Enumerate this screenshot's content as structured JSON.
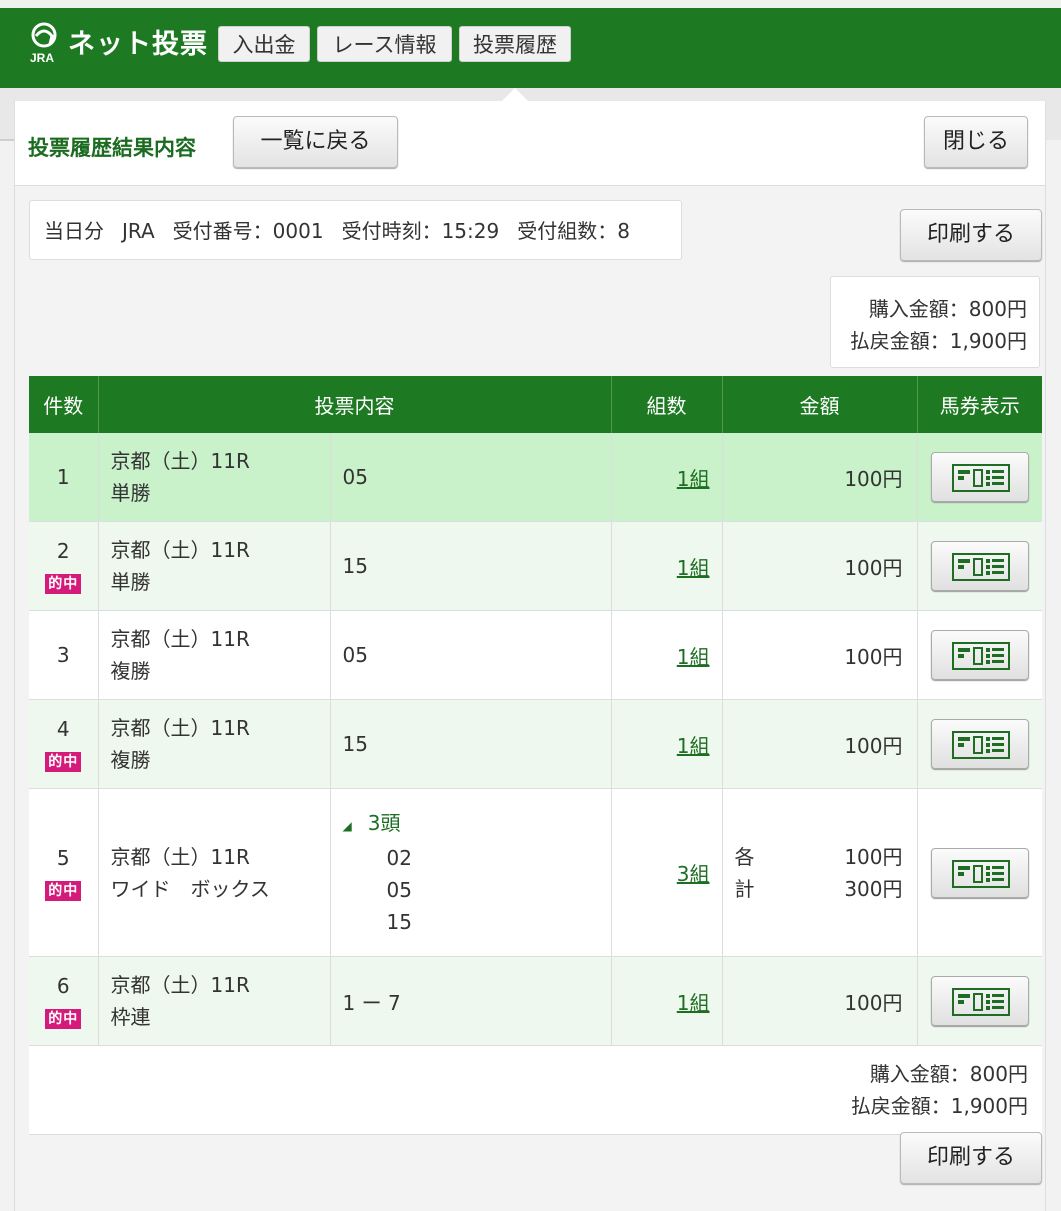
{
  "header": {
    "brand": "ネット投票",
    "logo_text": "JRA",
    "nav": [
      "入出金",
      "レース情報",
      "投票履歴"
    ]
  },
  "panel": {
    "title": "投票履歴結果内容",
    "back_label": "一覧に戻る",
    "close_label": "閉じる",
    "print_label": "印刷する"
  },
  "info": {
    "day": "当日分",
    "org": "JRA",
    "receipt_no": "受付番号：0001",
    "receipt_time": "受付時刻：15:29",
    "receipt_count": "受付組数：8"
  },
  "summary": {
    "purchase": "購入金額：800円",
    "payout": "払戻金額：1,900円"
  },
  "table": {
    "headers": [
      "件数",
      "投票内容",
      "組数",
      "金額",
      "馬券表示"
    ],
    "hit_label": "的中",
    "rows": [
      {
        "no": "1",
        "race": "京都（土）11R",
        "type": "単勝",
        "content": "05",
        "kumi": "1組",
        "amount": "100円"
      },
      {
        "no": "2",
        "race": "京都（土）11R",
        "type": "単勝",
        "content": "15",
        "kumi": "1組",
        "amount": "100円"
      },
      {
        "no": "3",
        "race": "京都（土）11R",
        "type": "複勝",
        "content": "05",
        "kumi": "1組",
        "amount": "100円"
      },
      {
        "no": "4",
        "race": "京都（土）11R",
        "type": "複勝",
        "content": "15",
        "kumi": "1組",
        "amount": "100円"
      },
      {
        "no": "5",
        "race": "京都（土）11R",
        "type": "ワイド　ボックス",
        "content_head": "3頭",
        "content_items": [
          "02",
          "05",
          "15"
        ],
        "kumi": "3組",
        "each_label": "各",
        "each_amount": "100円",
        "total_label": "計",
        "total_amount": "300円"
      },
      {
        "no": "6",
        "race": "京都（土）11R",
        "type": "枠連",
        "content": "1 ー 7",
        "kumi": "1組",
        "amount": "100円"
      }
    ]
  },
  "footer_summary": {
    "purchase": "購入金額：800円",
    "payout": "払戻金額：1,900円"
  },
  "colors": {
    "brand_green": "#1d7a22",
    "hit_badge": "#d41a7a",
    "highlight_row": "#c9f2cb"
  }
}
